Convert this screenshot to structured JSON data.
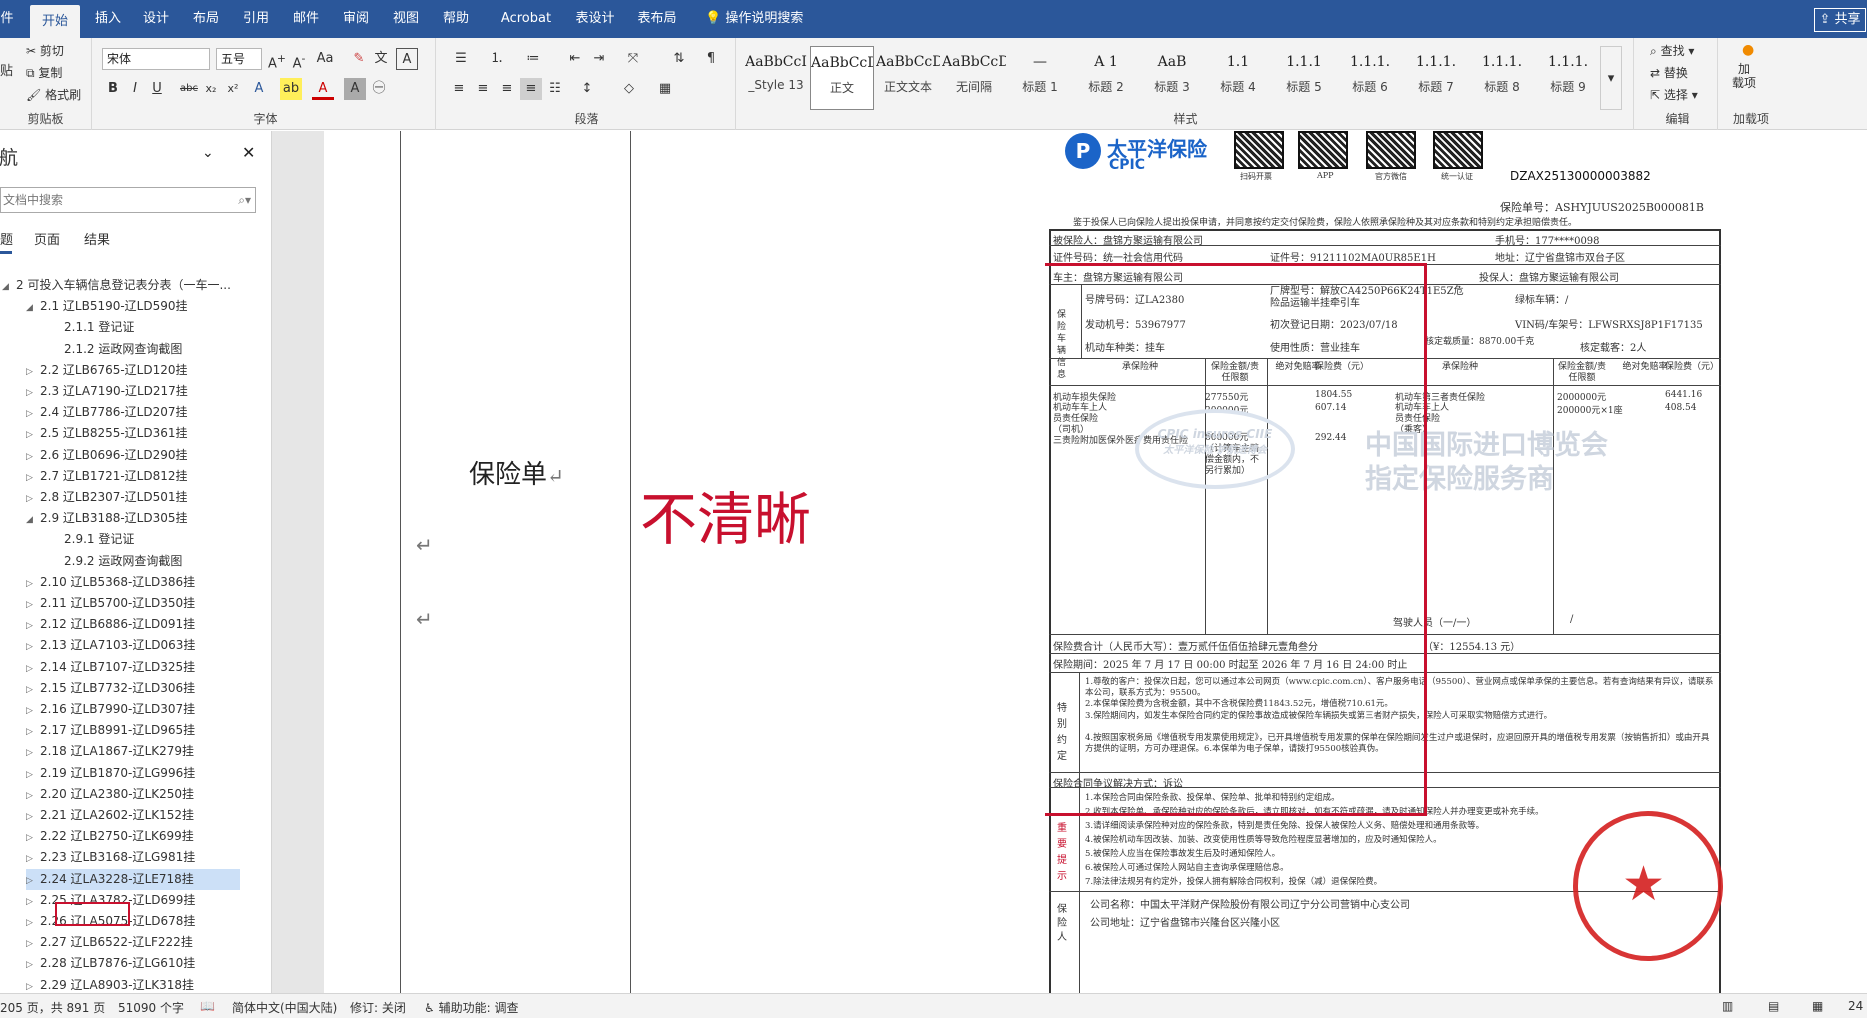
{
  "tabs": [
    "件",
    "开始",
    "插入",
    "设计",
    "布局",
    "引用",
    "邮件",
    "审阅",
    "视图",
    "帮助",
    "Acrobat",
    "表设计",
    "表布局"
  ],
  "tell_me": "操作说明搜索",
  "share": "共享",
  "ribbon": {
    "clipboard": {
      "cut": "剪切",
      "copy": "复制",
      "format_painter": "格式刷",
      "paste": "贴",
      "label": "剪贴板"
    },
    "font": {
      "name": "宋体",
      "size": "五号",
      "label": "字体"
    },
    "paragraph": {
      "label": "段落"
    },
    "styles": {
      "label": "样式",
      "items": [
        {
          "preview": "AaBbCcI",
          "name": "_Style 13"
        },
        {
          "preview": "AaBbCcDdI",
          "name": "正文"
        },
        {
          "preview": "AaBbCcDdI",
          "name": "正文文本"
        },
        {
          "preview": "AaBbCcDdI",
          "name": "无间隔"
        },
        {
          "preview": "—",
          "name": "标题 1"
        },
        {
          "preview": "A 1",
          "name": "标题 2"
        },
        {
          "preview": "AaB",
          "name": "标题 3"
        },
        {
          "preview": "1.1",
          "name": "标题 4"
        },
        {
          "preview": "1.1.1",
          "name": "标题 5"
        },
        {
          "preview": "1.1.1.",
          "name": "标题 6"
        },
        {
          "preview": "1.1.1.",
          "name": "标题 7"
        },
        {
          "preview": "1.1.1.",
          "name": "标题 8"
        },
        {
          "preview": "1.1.1.",
          "name": "标题 9"
        }
      ]
    },
    "editing": {
      "find": "查找",
      "replace": "替换",
      "select": "选择",
      "label": "编辑"
    },
    "addins": {
      "load": "加\n载项",
      "label": "加载项"
    }
  },
  "nav": {
    "title": "导航",
    "search_placeholder": "文档中搜索",
    "tabs": [
      "题",
      "页面",
      "结果"
    ],
    "headings": [
      {
        "text": "2 可投入车辆信息登记表分表（一车一...",
        "level": 0,
        "arrow": "◢"
      },
      {
        "text": "2.1 辽LB5190-辽LD590挂",
        "level": 1,
        "arrow": "◢"
      },
      {
        "text": "2.1.1 登记证",
        "level": 2,
        "arrow": ""
      },
      {
        "text": "2.1.2 运政网查询截图",
        "level": 2,
        "arrow": ""
      },
      {
        "text": "2.2 辽LB6765-辽LD120挂",
        "level": 1,
        "arrow": "▷"
      },
      {
        "text": "2.3 辽LA7190-辽LD217挂",
        "level": 1,
        "arrow": "▷"
      },
      {
        "text": "2.4 辽LB7786-辽LD207挂",
        "level": 1,
        "arrow": "▷"
      },
      {
        "text": "2.5 辽LB8255-辽LD361挂",
        "level": 1,
        "arrow": "▷"
      },
      {
        "text": "2.6 辽LB0696-辽LD290挂",
        "level": 1,
        "arrow": "▷"
      },
      {
        "text": "2.7 辽LB1721-辽LD812挂",
        "level": 1,
        "arrow": "▷"
      },
      {
        "text": "2.8 辽LB2307-辽LD501挂",
        "level": 1,
        "arrow": "▷"
      },
      {
        "text": "2.9 辽LB3188-辽LD305挂",
        "level": 1,
        "arrow": "◢"
      },
      {
        "text": "2.9.1 登记证",
        "level": 2,
        "arrow": ""
      },
      {
        "text": "2.9.2 运政网查询截图",
        "level": 2,
        "arrow": ""
      },
      {
        "text": "2.10 辽LB5368-辽LD386挂",
        "level": 1,
        "arrow": "▷"
      },
      {
        "text": "2.11 辽LB5700-辽LD350挂",
        "level": 1,
        "arrow": "▷"
      },
      {
        "text": "2.12 辽LB6886-辽LD091挂",
        "level": 1,
        "arrow": "▷"
      },
      {
        "text": "2.13 辽LA7103-辽LD063挂",
        "level": 1,
        "arrow": "▷"
      },
      {
        "text": "2.14 辽LB7107-辽LD325挂",
        "level": 1,
        "arrow": "▷"
      },
      {
        "text": "2.15 辽LB7732-辽LD306挂",
        "level": 1,
        "arrow": "▷"
      },
      {
        "text": "2.16 辽LB7990-辽LD307挂",
        "level": 1,
        "arrow": "▷"
      },
      {
        "text": "2.17 辽LB8991-辽LD965挂",
        "level": 1,
        "arrow": "▷"
      },
      {
        "text": "2.18 辽LA1867-辽LK279挂",
        "level": 1,
        "arrow": "▷"
      },
      {
        "text": "2.19 辽LB1870-辽LG996挂",
        "level": 1,
        "arrow": "▷"
      },
      {
        "text": "2.20 辽LA2380-辽LK250挂",
        "level": 1,
        "arrow": "▷"
      },
      {
        "text": "2.21 辽LA2602-辽LK152挂",
        "level": 1,
        "arrow": "▷"
      },
      {
        "text": "2.22 辽LB2750-辽LK699挂",
        "level": 1,
        "arrow": "▷"
      },
      {
        "text": "2.23 辽LB3168-辽LG981挂",
        "level": 1,
        "arrow": "▷"
      },
      {
        "text": "2.24 辽LA3228-辽LE718挂",
        "level": 1,
        "arrow": "▷"
      },
      {
        "text": "2.25 辽LA3782-辽LD699挂",
        "level": 1,
        "arrow": "▷"
      },
      {
        "text": "2.26 辽LA5075-辽LD678挂",
        "level": 1,
        "arrow": "▷"
      },
      {
        "text": "2.27 辽LB6522-辽LF222挂",
        "level": 1,
        "arrow": "▷"
      },
      {
        "text": "2.28 辽LB7876-辽LG610挂",
        "level": 1,
        "arrow": "▷"
      },
      {
        "text": "2.29 辽LA8903-辽LK318挂",
        "level": 1,
        "arrow": "▷"
      }
    ]
  },
  "document": {
    "cell_label": "保险单",
    "annotation": "不清晰",
    "annotation_color": "#c8102e",
    "policy": {
      "brand_cn": "太平洋保险",
      "brand_en": "CPIC",
      "qr_labels": [
        "扫码开票",
        "APP",
        "官方微信",
        "统一认证"
      ],
      "doc_code": "DZAX25130000003882",
      "policy_no": "保险单号：ASHYJUUS2025B000081B",
      "intro": "鉴于投保人已向保险人提出投保申请，并同意按约定交付保险费，保险人依照承保险种及其对应条款和特别约定承担赔偿责任。",
      "insured": "被保险人：盘锦方聚运输有限公司",
      "phone": "手机号：177****0098",
      "cert": "证件号码：统一社会信用代码",
      "cert_no": "证件号：91211102MA0UR85E1H",
      "address": "地址：辽宁省盘锦市双台子区",
      "owner": "车主：盘锦方聚运输有限公司",
      "applicant": "投保人：盘锦方聚运输有限公司",
      "vehicle_label": "保险车辆信息",
      "plate": "号牌号码：辽LA2380",
      "model": "厂牌型号：解放CA4250P66K24T1E5Z危险品运输半挂牵引车",
      "green": "绿标车辆：/",
      "engine": "发动机号：53967977",
      "regdate": "初次登记日期：2023/07/18",
      "vin": "VIN码/车架号：LFWSRXSJ8P1F17135",
      "vtype": "机动车种类：挂车",
      "usage": "使用性质：营业挂车",
      "quality": "核定载质量：8870.00千克",
      "seats": "核定载客：2人",
      "cov_headers": [
        "承保险种",
        "保险金额/责任限额",
        "绝对免赔率",
        "保险费（元）",
        "承保险种",
        "保险金额/责任限额",
        "绝对免赔率",
        "保险费（元）"
      ],
      "cov1": [
        "机动车损失保险",
        "277550元",
        "",
        "1804.55",
        "机动车第三者责任保险",
        "2000000元",
        "",
        "6441.16"
      ],
      "cov2": [
        "机动车车上人员责任保险（司机）",
        "200000元",
        "",
        "607.14",
        "机动车车上人员责任保险（乘客）",
        "200000元×1座",
        "",
        "408.54"
      ],
      "cov3": [
        "三责险附加医保外医疗费用责任险",
        "600000元（计算车主赔偿金额内，不另行累加）",
        "",
        "292.44",
        "",
        "",
        "",
        ""
      ],
      "deductible": "驾驶人员（一/一）",
      "slash": "/",
      "total": "保险费合计（人民币大写）：壹万贰仟伍佰伍拾肆元壹角叁分",
      "total_num": "（¥：12554.13 元）",
      "period": "保险期间：2025 年 7 月 17 日 00:00 时起至 2026 年 7 月 16 日 24:00 时止",
      "special_label": "特别约定",
      "special": [
        "1.尊敬的客户：投保次日起，您可以通过本公司网页（www.cpic.com.cn）、客户服务电话（95500）、营业网点或保单承保的主要信息。若有查询结果有异议，请联系本公司，联系方式为：95500。",
        "2.本保单保险费为含税金额，其中不含税保险费11843.52元，增值税710.61元。",
        "3.保险期间内，如发生本保险合同约定的保险事故造成被保险车辆损失或第三者财产损失，保险人可采取实物赔偿方式进行。",
        "4.按照国家税务局《增值税专用发票使用规定》，已开具增值税专用发票的保单在保险期间发生过户或退保时，应退回原开具的增值税专用发票（按销售折扣）或由开具方提供的证明，方可办理退保。6.本保单为电子保单，请拨打95500核验真伪。"
      ],
      "dispute": "保险合同争议解决方式：诉讼",
      "notes_label": "重要提示",
      "notes": [
        "1.本保险合同由保险条款、投保单、保险单、批单和特别约定组成。",
        "2.收到本保险单、承保险种对应的保险条款后，请立即核对，如有不符或疏漏，请及时通知保险人并办理变更或补充手续。",
        "3.请详细阅读承保险种对应的保险条款，特别是责任免除、投保人被保险人义务、赔偿处理和通用条款等。",
        "4.被保险机动车因改装、加装、改变使用性质等导致危险程度显著增加的，应及时通知保险人。",
        "5.被保险人应当在保险事故发生后及时通知保险人。",
        "6.被保险人可通过保险人网站自主查询承保理赔信息。",
        "7.除法律法规另有约定外，投保人拥有解除合同权利，投保（减）退保保险费。"
      ],
      "insurer_label": "保险人",
      "insurer_name": "公司名称：中国太平洋财产保险股份有限公司辽宁分公司营销中心支公司",
      "insurer_addr": "公司地址：辽宁省盘锦市兴隆台区兴隆小区",
      "watermark1": "中国国际进口博览会",
      "watermark2": "指定保险服务商",
      "wm_logo": "CPIC insures CIIE",
      "wm_logo2": "太平洋保险 护航进博会"
    }
  },
  "statusbar": {
    "page": "205 页，共 891 页",
    "words": "51090 个字",
    "lang": "简体中文(中国大陆)",
    "track": "修订: 关闭",
    "access": "辅助功能: 调查",
    "zoom": "24"
  }
}
